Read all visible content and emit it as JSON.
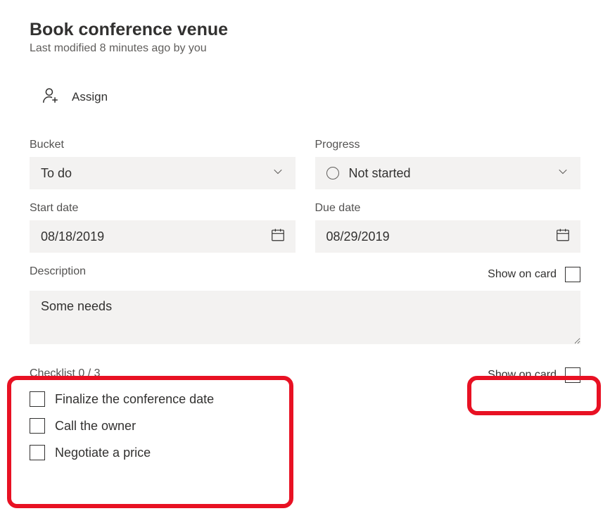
{
  "task": {
    "title": "Book conference venue",
    "modified": "Last modified 8 minutes ago by you"
  },
  "assign": {
    "label": "Assign"
  },
  "fields": {
    "bucket_label": "Bucket",
    "bucket_value": "To do",
    "progress_label": "Progress",
    "progress_value": "Not started",
    "start_label": "Start date",
    "start_value": "08/18/2019",
    "due_label": "Due date",
    "due_value": "08/29/2019",
    "description_label": "Description",
    "description_value": "Some needs",
    "show_on_card": "Show on card"
  },
  "checklist": {
    "title": "Checklist 0 / 3",
    "items": [
      "Finalize the conference date",
      "Call the owner",
      "Negotiate a price"
    ],
    "show_on_card": "Show on card"
  }
}
